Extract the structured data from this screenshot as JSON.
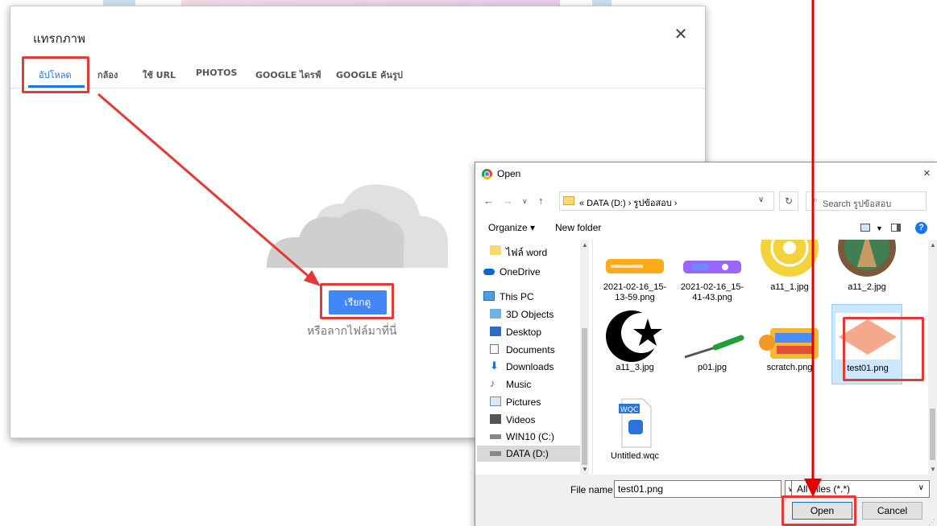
{
  "google_dialog": {
    "title": "แทรกภาพ",
    "tabs": [
      {
        "label": "อัปโหลด",
        "active": true
      },
      {
        "label": "กล้อง"
      },
      {
        "label": "ใช้ URL"
      },
      {
        "label": "PHOTOS"
      },
      {
        "label": "GOOGLE ไดรฟ์"
      },
      {
        "label": "GOOGLE ค้นรูป"
      }
    ],
    "browse_button": "เรียกดู",
    "drop_hint": "หรือลากไฟล์มาที่นี่",
    "accent_color": "#1a73e8"
  },
  "file_dialog": {
    "title": "Open",
    "close_icon": "×",
    "address_path": "« DATA (D:) › รูปข้อสอบ ›",
    "search_placeholder": "Search รูปข้อสอบ",
    "organize_label": "Organize ▾",
    "new_folder_label": "New folder",
    "nav_items": [
      {
        "label": "ไฟล์ word",
        "icon": "folder-icon"
      },
      {
        "label": "OneDrive",
        "icon": "cloud-icon"
      },
      {
        "label": "This PC",
        "icon": "computer-icon"
      },
      {
        "label": "3D Objects",
        "icon": "cube-icon"
      },
      {
        "label": "Desktop",
        "icon": "desktop-icon"
      },
      {
        "label": "Documents",
        "icon": "document-icon"
      },
      {
        "label": "Downloads",
        "icon": "download-icon"
      },
      {
        "label": "Music",
        "icon": "music-icon"
      },
      {
        "label": "Pictures",
        "icon": "pictures-icon"
      },
      {
        "label": "Videos",
        "icon": "video-icon"
      },
      {
        "label": "WIN10 (C:)",
        "icon": "drive-icon"
      },
      {
        "label": "DATA (D:)",
        "icon": "drive-icon",
        "selected": true
      }
    ],
    "files": [
      {
        "name": "2021-02-16_15-13-59.png"
      },
      {
        "name": "2021-02-16_15-41-43.png"
      },
      {
        "name": "a11_1.jpg"
      },
      {
        "name": "a11_2.jpg"
      },
      {
        "name": "a11_3.jpg"
      },
      {
        "name": "p01.jpg"
      },
      {
        "name": "scratch.png"
      },
      {
        "name": "test01.png",
        "selected": true
      },
      {
        "name": "Untitled.wqc"
      }
    ],
    "file_name_label": "File name:",
    "file_name_value": "test01.png",
    "file_type": "All Files (*.*)",
    "open_button": "Open",
    "cancel_button": "Cancel"
  },
  "annotation_color": "#e53935"
}
